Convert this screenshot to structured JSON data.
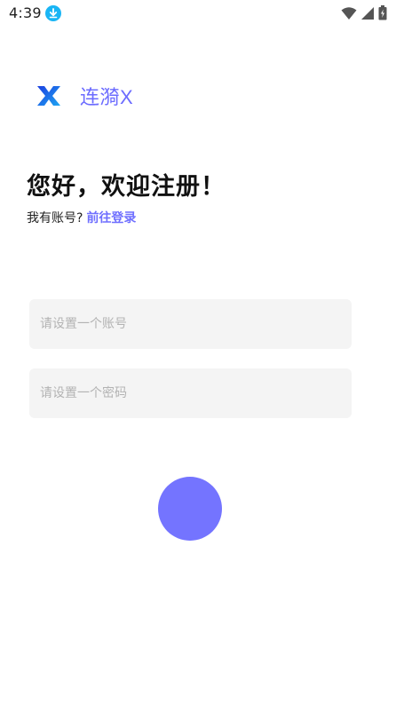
{
  "status_bar": {
    "time": "4:39",
    "icons": [
      "download-icon",
      "wifi-icon",
      "signal-icon",
      "battery-icon"
    ]
  },
  "brand": {
    "name": "连漪X",
    "logo": "x-logo-icon",
    "color": "#6c6cff"
  },
  "headline": {
    "title": "您好，欢迎注册！",
    "prompt": "我有账号?",
    "login_link": "前往登录"
  },
  "form": {
    "account_placeholder": "请设置一个账号",
    "password_placeholder": "请设置一个密码",
    "account_value": "",
    "password_value": ""
  },
  "colors": {
    "accent": "#6f6fff",
    "field_bg": "#f4f4f4",
    "submit": "#7474ff"
  }
}
